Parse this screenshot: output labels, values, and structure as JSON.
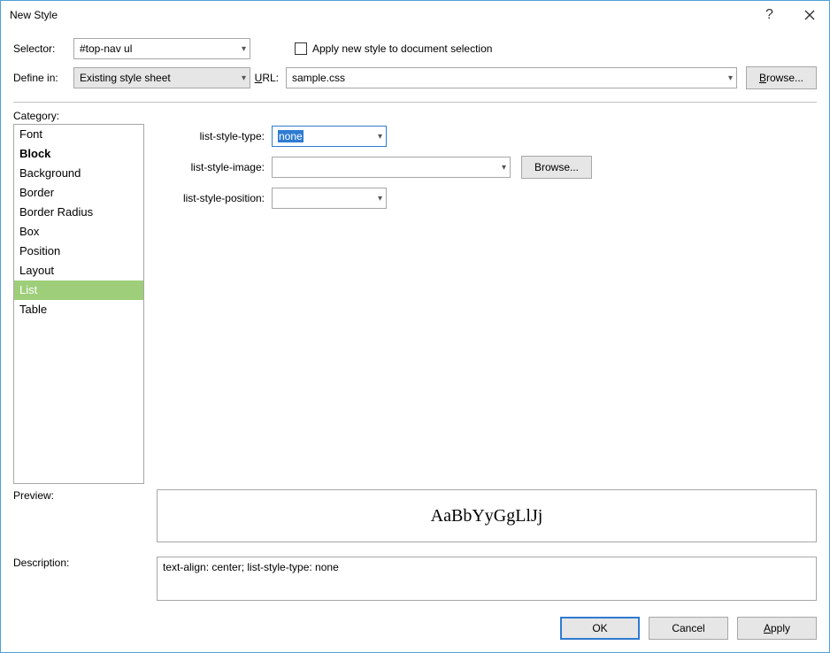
{
  "titlebar": {
    "title": "New Style"
  },
  "top": {
    "selector_label": "Selector:",
    "selector_value": "#top-nav ul",
    "apply_checkbox_label": "Apply new style to document selection",
    "define_in_label": "Define in:",
    "define_in_value": "Existing style sheet",
    "url_label": "URL:",
    "url_value": "sample.css",
    "browse_label": "Browse..."
  },
  "category": {
    "label": "Category:",
    "items": [
      {
        "label": "Font",
        "bold": false,
        "selected": false
      },
      {
        "label": "Block",
        "bold": true,
        "selected": false
      },
      {
        "label": "Background",
        "bold": false,
        "selected": false
      },
      {
        "label": "Border",
        "bold": false,
        "selected": false
      },
      {
        "label": "Border Radius",
        "bold": false,
        "selected": false
      },
      {
        "label": "Box",
        "bold": false,
        "selected": false
      },
      {
        "label": "Position",
        "bold": false,
        "selected": false
      },
      {
        "label": "Layout",
        "bold": false,
        "selected": false
      },
      {
        "label": "List",
        "bold": false,
        "selected": true
      },
      {
        "label": "Table",
        "bold": false,
        "selected": false
      }
    ]
  },
  "props": {
    "list_style_type_label": "list-style-type:",
    "list_style_type_value": "none",
    "list_style_image_label": "list-style-image:",
    "list_style_image_value": "",
    "browse_label": "Browse...",
    "list_style_position_label": "list-style-position:",
    "list_style_position_value": ""
  },
  "preview": {
    "label": "Preview:",
    "sample": "AaBbYyGgLlJj"
  },
  "description": {
    "label": "Description:",
    "text": "text-align: center; list-style-type: none"
  },
  "footer": {
    "ok": "OK",
    "cancel": "Cancel",
    "apply": "Apply"
  }
}
